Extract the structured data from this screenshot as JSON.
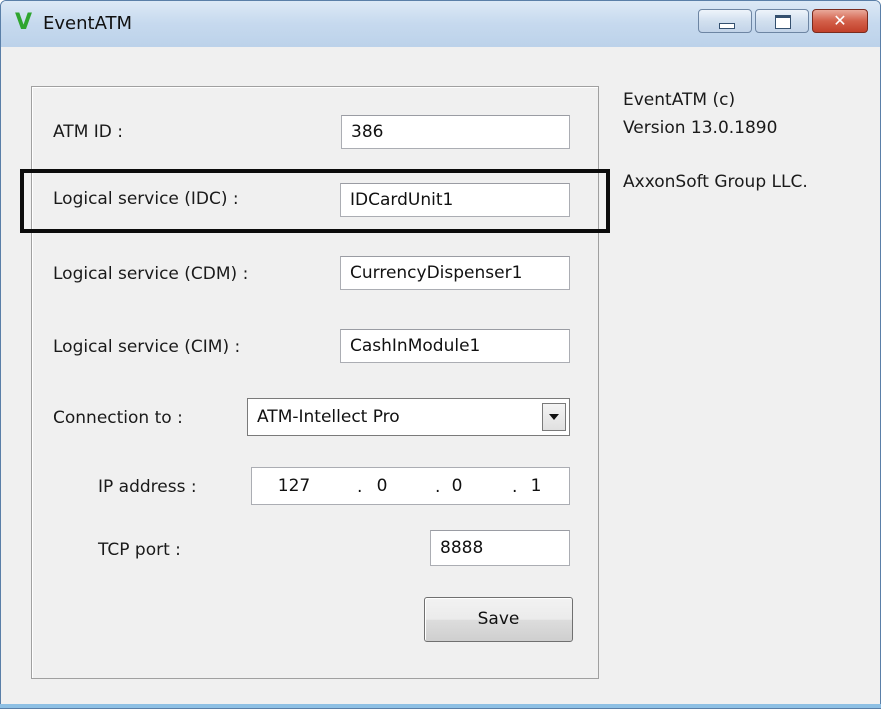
{
  "window": {
    "title": "EventATM",
    "logo_letter": "V",
    "controls": {
      "minimize": "minimize-icon",
      "maximize": "maximize-icon",
      "close": "close-icon",
      "close_glyph": "✕"
    }
  },
  "form": {
    "atm_id": {
      "label": "ATM ID :",
      "value": "386"
    },
    "logical_idc": {
      "label": "Logical service (IDC) :",
      "value": "IDCardUnit1"
    },
    "logical_cdm": {
      "label": "Logical service (CDM) :",
      "value": "CurrencyDispenser1"
    },
    "logical_cim": {
      "label": "Logical service (CIM) :",
      "value": "CashInModule1"
    },
    "connection": {
      "label": "Connection to :",
      "selected": "ATM-Intellect Pro"
    },
    "ip_address": {
      "label": "IP address :",
      "octets": [
        "127",
        "0",
        "0",
        "1"
      ],
      "dot": "."
    },
    "tcp_port": {
      "label": "TCP port :",
      "value": "8888"
    },
    "save_label": "Save"
  },
  "about": {
    "product": "EventATM (c)",
    "version": "Version 13.0.1890",
    "company": "AxxonSoft Group LLC."
  },
  "colors": {
    "logo": "#2fa52f",
    "title_bar": "#c6d9ee",
    "close_button": "#c2402a",
    "highlight_border": "#0b0b0b"
  }
}
